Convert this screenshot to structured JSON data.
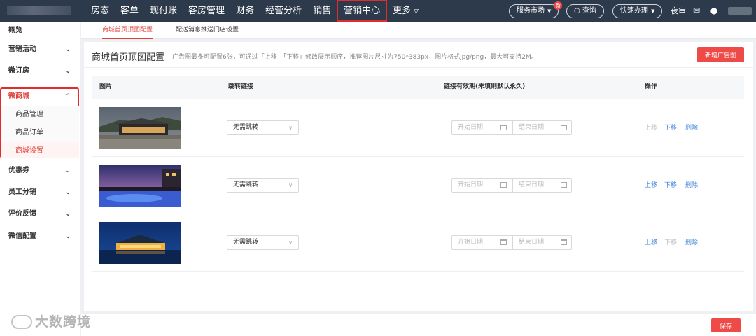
{
  "topnav": {
    "items": [
      "房态",
      "客单",
      "现付账",
      "客房管理",
      "财务",
      "经营分析",
      "销售",
      "营销中心",
      "更多"
    ],
    "service_market": "服务市场",
    "service_badge": "新",
    "search": "查询",
    "quick": "快速办理",
    "night_audit": "夜审"
  },
  "sidebar": {
    "items": [
      "概览",
      "营销活动",
      "微订房",
      "微商城",
      "优惠券",
      "员工分销",
      "评价反馈",
      "微信配置"
    ],
    "sub_items": [
      "商品管理",
      "商品订单",
      "商城设置"
    ]
  },
  "tabs": [
    "商城首页顶图配置",
    "配送消息推送门店设置"
  ],
  "card": {
    "title": "商城首页顶图配置",
    "hint": "广告图最多可配置6张，可通过「上移」「下移」修改展示顺序，推荐图片尺寸为750*383px，图片格式jpg/png，最大可支持2M。",
    "add_button": "新增广告图"
  },
  "table": {
    "headers": [
      "图片",
      "跳转链接",
      "链接有效期(未填则默认永久)",
      "操作"
    ],
    "rows": [
      {
        "link": "无需跳转",
        "start": "开始日期",
        "end": "结束日期",
        "up": "上移",
        "down": "下移",
        "del": "删除",
        "up_enabled": false,
        "down_enabled": true
      },
      {
        "link": "无需跳转",
        "start": "开始日期",
        "end": "结束日期",
        "up": "上移",
        "down": "下移",
        "del": "删除",
        "up_enabled": true,
        "down_enabled": true
      },
      {
        "link": "无需跳转",
        "start": "开始日期",
        "end": "结束日期",
        "up": "上移",
        "down": "下移",
        "del": "删除",
        "up_enabled": true,
        "down_enabled": false
      }
    ]
  },
  "footer": {
    "save": "保存"
  },
  "watermark": "大数跨境",
  "colors": {
    "nav_bg": "#2d3a4b",
    "accent_red": "#e0433e",
    "link_blue": "#3b82d8"
  }
}
